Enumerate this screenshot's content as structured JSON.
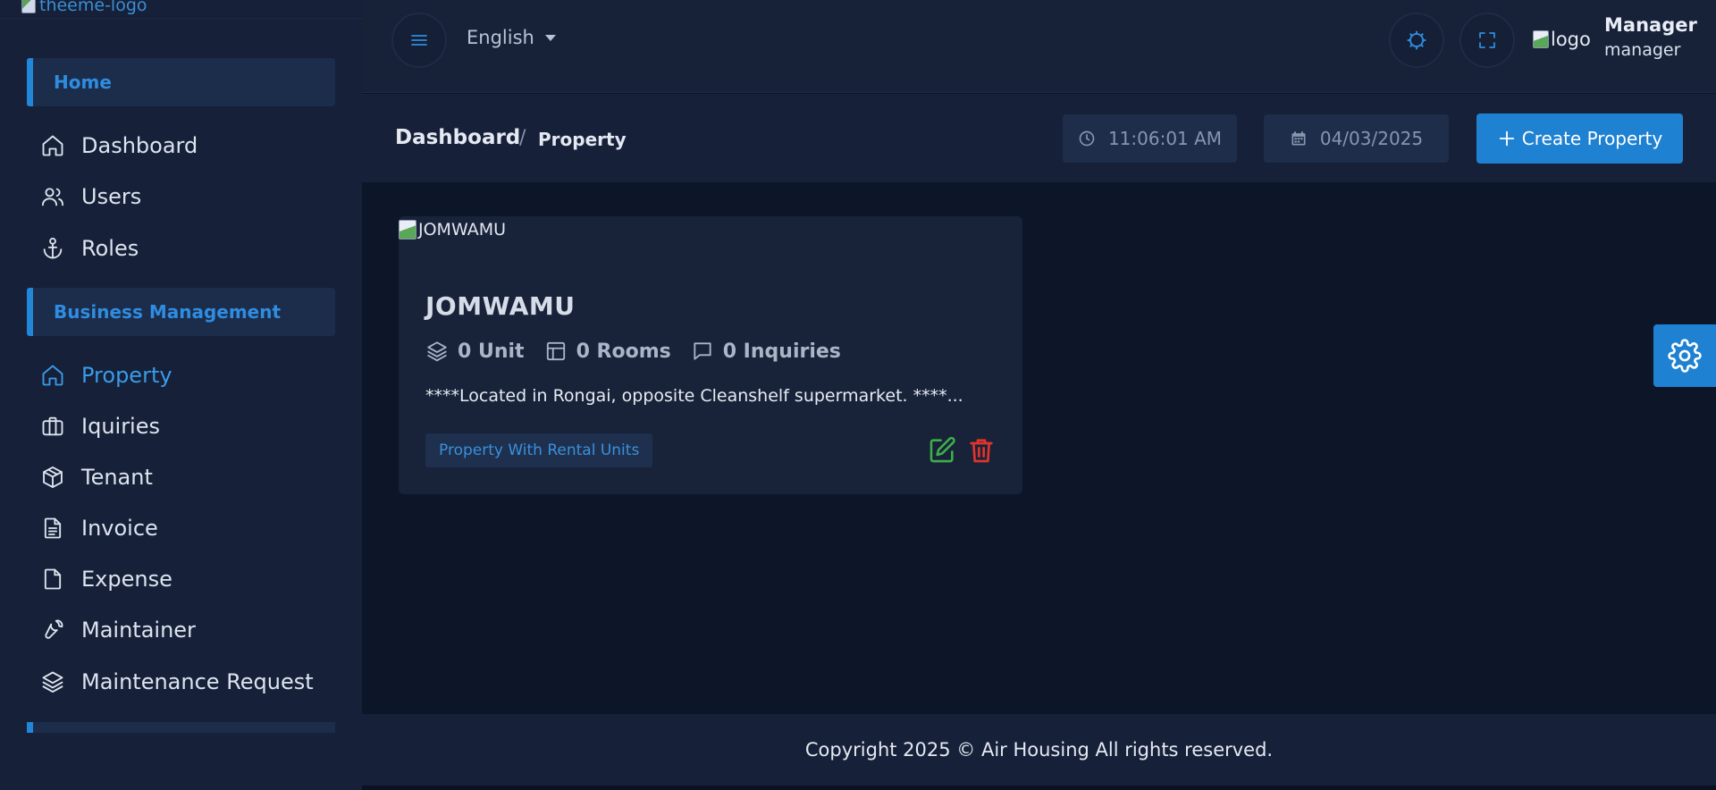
{
  "brand": {
    "logo_alt": "theeme-logo"
  },
  "sidebar": {
    "sections": [
      {
        "label": "Home"
      },
      {
        "label": "Business Management"
      }
    ],
    "items": [
      {
        "label": "Dashboard",
        "icon": "home-icon"
      },
      {
        "label": "Users",
        "icon": "users-icon"
      },
      {
        "label": "Roles",
        "icon": "anchor-icon"
      },
      {
        "label": "Property",
        "icon": "home-icon",
        "active": true
      },
      {
        "label": "Iquiries",
        "icon": "briefcase-icon"
      },
      {
        "label": "Tenant",
        "icon": "box-icon"
      },
      {
        "label": "Invoice",
        "icon": "file-text-icon"
      },
      {
        "label": "Expense",
        "icon": "file-icon"
      },
      {
        "label": "Maintainer",
        "icon": "wrench-icon"
      },
      {
        "label": "Maintenance Request",
        "icon": "layers-icon"
      }
    ]
  },
  "topbar": {
    "language": "English",
    "user_logo_alt": "logo",
    "user_name": "Manager",
    "user_role": "manager"
  },
  "breadcrumb": {
    "home": "Dashboard",
    "separator": "/",
    "current": "Property"
  },
  "toolbar": {
    "time": "11:06:01 AM",
    "date": "04/03/2025",
    "create_label": "Create Property"
  },
  "property_card": {
    "image_alt": "JOMWAMU",
    "title": "JOMWAMU",
    "units": "0 Unit",
    "rooms": "0 Rooms",
    "inquiries": "0 Inquiries",
    "description": "****Located in Rongai, opposite Cleanshelf supermarket. ****...",
    "tag": "Property With Rental Units"
  },
  "footer": {
    "text": "Copyright 2025 © Air Housing All rights reserved."
  },
  "colors": {
    "accent": "#1f81d1",
    "edit": "#3fae4a",
    "delete": "#e0342a",
    "background": "#0d1529",
    "panel": "#162038"
  }
}
